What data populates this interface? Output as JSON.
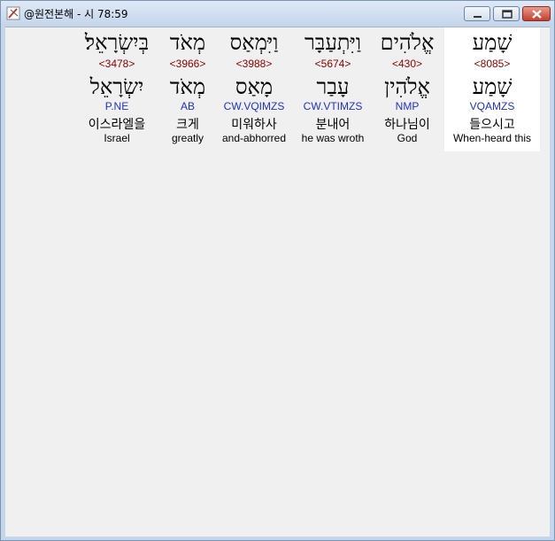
{
  "window": {
    "title": "@원전본해 - 시 78:59"
  },
  "colors": {
    "strong": "#8b0000",
    "parse": "#1f32c8",
    "highlight": "#ffffff",
    "background": "#f0f0f0"
  },
  "words": [
    {
      "hebrew": "שָׁמַע",
      "strong": "<8085>",
      "lemma": "שָׁמַע",
      "parse": "VQAMZS",
      "korean": "들으시고",
      "english": "When-heard this"
    },
    {
      "hebrew": "אֱלֹהִים",
      "strong": "<430>",
      "lemma": "אֱלֹהִין",
      "parse": "NMP",
      "korean": "하나님이",
      "english": "God"
    },
    {
      "hebrew": "וַיִּתְעַבָּר",
      "strong": "<5674>",
      "lemma": "עָבַר",
      "parse": "CW.VTIMZS",
      "korean": "분내어",
      "english": "he was wroth"
    },
    {
      "hebrew": "וַיִּמְאַס",
      "strong": "<3988>",
      "lemma": "מָאַס",
      "parse": "CW.VQIMZS",
      "korean": "미워하사",
      "english": "and-abhorred"
    },
    {
      "hebrew": "מְאֹד",
      "strong": "<3966>",
      "lemma": "מְאֹד",
      "parse": "AB",
      "korean": "크게",
      "english": "greatly"
    },
    {
      "hebrew": "בְּיִשְׂרָאֵל׃",
      "strong": "<3478>",
      "lemma": "יִשְׂרָאֵל",
      "parse": "P.NE",
      "korean": "이스라엘을",
      "english": "Israel"
    }
  ]
}
